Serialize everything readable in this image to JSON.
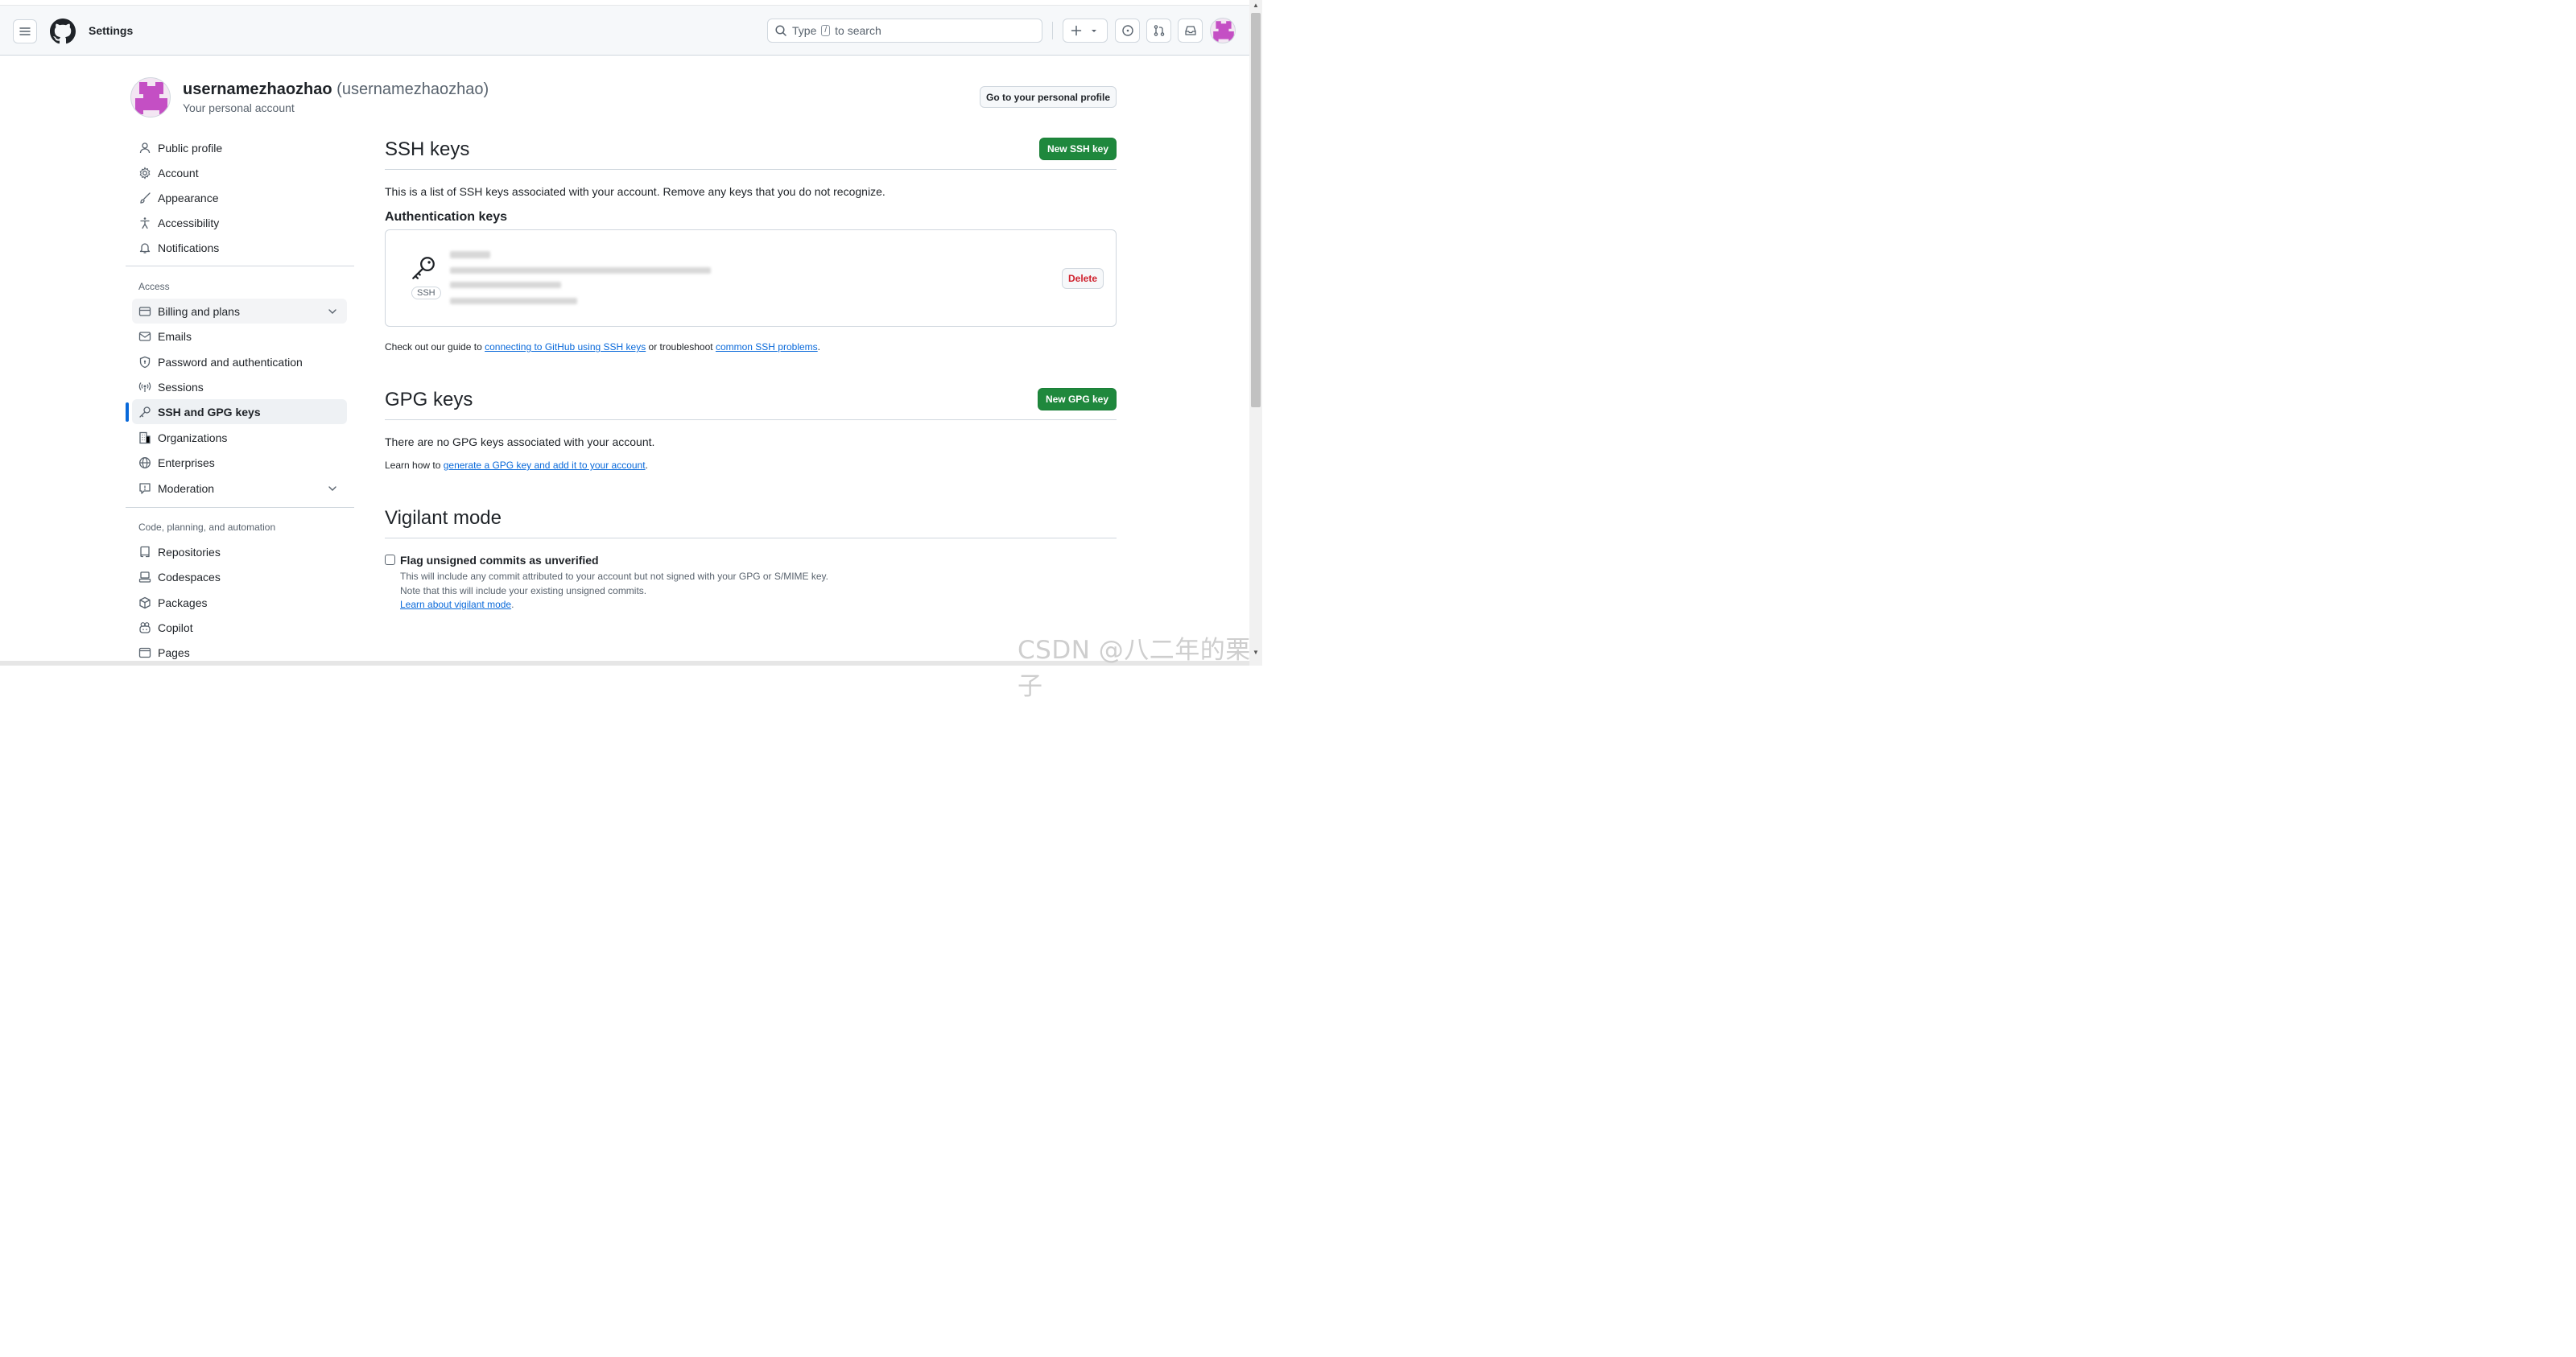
{
  "topbar": {
    "title": "Settings",
    "search_label": "Type",
    "search_key": "/",
    "search_suffix": "to search",
    "icons": [
      "menu-icon",
      "github-logo",
      "search-icon",
      "plus-icon",
      "caret-down-icon",
      "issues-icon",
      "pull-requests-icon",
      "inbox-icon",
      "avatar"
    ]
  },
  "header": {
    "username": "usernamezhaozhao",
    "login": "(usernamezhaozhao)",
    "subtitle": "Your personal account",
    "profile_button": "Go to your personal profile"
  },
  "sidebar": {
    "items_top": [
      {
        "label": "Public profile",
        "icon": "person-icon"
      },
      {
        "label": "Account",
        "icon": "gear-icon"
      },
      {
        "label": "Appearance",
        "icon": "paintbrush-icon"
      },
      {
        "label": "Accessibility",
        "icon": "accessibility-icon"
      },
      {
        "label": "Notifications",
        "icon": "bell-icon"
      }
    ],
    "access_heading": "Access",
    "items_access": [
      {
        "label": "Billing and plans",
        "icon": "credit-card-icon"
      },
      {
        "label": "Emails",
        "icon": "mail-icon"
      },
      {
        "label": "Password and authentication",
        "icon": "shield-lock-icon"
      },
      {
        "label": "Sessions",
        "icon": "broadcast-icon"
      },
      {
        "label": "SSH and GPG keys",
        "icon": "key-icon"
      },
      {
        "label": "Organizations",
        "icon": "organization-icon"
      },
      {
        "label": "Enterprises",
        "icon": "globe-icon"
      },
      {
        "label": "Moderation",
        "icon": "report-icon"
      }
    ],
    "code_heading": "Code, planning, and automation",
    "items_code": [
      {
        "label": "Repositories",
        "icon": "repo-icon"
      },
      {
        "label": "Codespaces",
        "icon": "codespaces-icon"
      },
      {
        "label": "Packages",
        "icon": "package-icon"
      },
      {
        "label": "Copilot",
        "icon": "copilot-icon"
      },
      {
        "label": "Pages",
        "icon": "browser-icon"
      }
    ]
  },
  "ssh": {
    "title": "SSH keys",
    "new_button": "New SSH key",
    "description": "This is a list of SSH keys associated with your account. Remove any keys that you do not recognize.",
    "auth_heading": "Authentication keys",
    "badge": "SSH",
    "delete_button": "Delete",
    "guide_prefix": "Check out our guide to",
    "guide_link": "connecting to GitHub using SSH keys",
    "guide_middle": "or troubleshoot",
    "guide_link2": "common SSH problems",
    "guide_suffix": "."
  },
  "gpg": {
    "title": "GPG keys",
    "new_button": "New GPG key",
    "description": "There are no GPG keys associated with your account.",
    "learn_prefix": "Learn how to",
    "learn_link": "generate a GPG key and add it to your account",
    "learn_suffix": "."
  },
  "vigilant": {
    "title": "Vigilant mode",
    "checkbox_label": "Flag unsigned commits as unverified",
    "checked": false,
    "note1": "This will include any commit attributed to your account but not signed with your GPG or S/MIME key.",
    "note2": "Note that this will include your existing unsigned commits.",
    "learn_link": "Learn about vigilant mode",
    "learn_suffix": "."
  },
  "watermark": "CSDN @八二年的栗子",
  "colors": {
    "accent": "#0969da",
    "green": "#1f883d",
    "danger": "#cf222e",
    "avatar": "#c44fc4"
  }
}
